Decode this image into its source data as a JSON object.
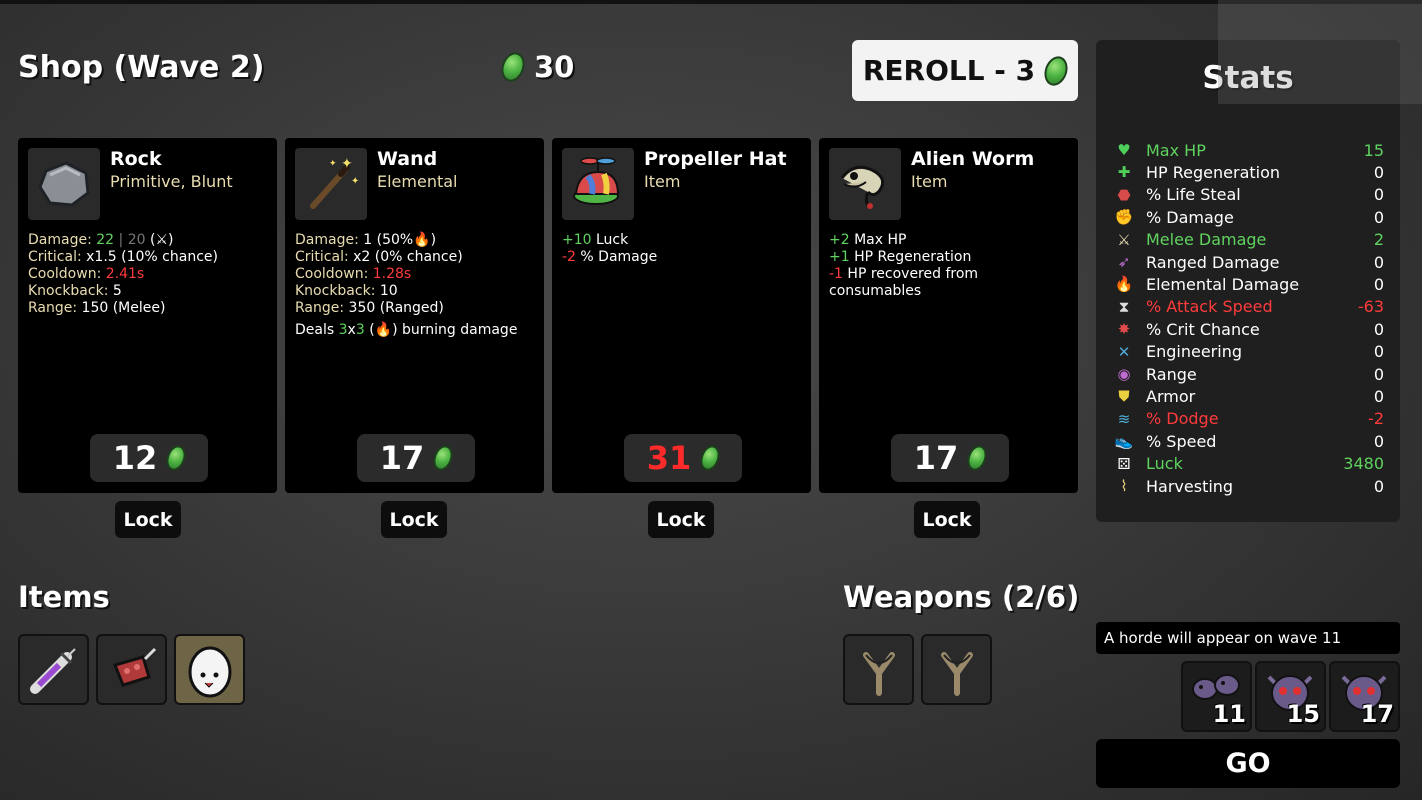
{
  "header": {
    "title": "Shop (Wave 2)",
    "gold": "30",
    "reroll_label": "REROLL - 3"
  },
  "shop": [
    {
      "name": "Rock",
      "type": "Primitive, Blunt",
      "icon": "rock-icon",
      "price": "12",
      "price_color": "#ffffff",
      "lock_label": "Lock",
      "lines": [
        {
          "label": "Damage:",
          "parts": [
            {
              "t": " "
            },
            {
              "t": "22",
              "c": "green"
            },
            {
              "t": " | ",
              "c": "grey"
            },
            {
              "t": "20",
              "c": "grey"
            },
            {
              "t": " (⚔)"
            }
          ]
        },
        {
          "label": "Critical:",
          "parts": [
            {
              "t": " x1.5 (10% chance)"
            }
          ]
        },
        {
          "label": "Cooldown:",
          "parts": [
            {
              "t": " "
            },
            {
              "t": "2.41s",
              "c": "red"
            }
          ]
        },
        {
          "label": "Knockback:",
          "parts": [
            {
              "t": " 5"
            }
          ]
        },
        {
          "label": "Range:",
          "parts": [
            {
              "t": " 150 (Melee)"
            }
          ]
        }
      ]
    },
    {
      "name": "Wand",
      "type": "Elemental",
      "icon": "wand-icon",
      "price": "17",
      "price_color": "#ffffff",
      "lock_label": "Lock",
      "lines": [
        {
          "label": "Damage:",
          "parts": [
            {
              "t": " 1 (50%🔥)"
            }
          ]
        },
        {
          "label": "Critical:",
          "parts": [
            {
              "t": " x2 (0% chance)"
            }
          ]
        },
        {
          "label": "Cooldown:",
          "parts": [
            {
              "t": " "
            },
            {
              "t": "1.28s",
              "c": "red"
            }
          ]
        },
        {
          "label": "Knockback:",
          "parts": [
            {
              "t": " 10"
            }
          ]
        },
        {
          "label": "Range:",
          "parts": [
            {
              "t": " 350 (Ranged)"
            }
          ]
        },
        {
          "label": "",
          "parts": [
            {
              "t": "Deals "
            },
            {
              "t": "3",
              "c": "green"
            },
            {
              "t": "x"
            },
            {
              "t": "3",
              "c": "green"
            },
            {
              "t": " (🔥) burning damage"
            }
          ]
        }
      ]
    },
    {
      "name": "Propeller Hat",
      "type": "Item",
      "icon": "propeller-hat-icon",
      "price": "31",
      "price_color": "#ff2a2a",
      "lock_label": "Lock",
      "lines": [
        {
          "label": "",
          "parts": [
            {
              "t": "+10",
              "c": "green"
            },
            {
              "t": " Luck"
            }
          ]
        },
        {
          "label": "",
          "parts": [
            {
              "t": "-2",
              "c": "red"
            },
            {
              "t": " % Damage"
            }
          ]
        }
      ]
    },
    {
      "name": "Alien Worm",
      "type": "Item",
      "icon": "alien-worm-icon",
      "price": "17",
      "price_color": "#ffffff",
      "lock_label": "Lock",
      "lines": [
        {
          "label": "",
          "parts": [
            {
              "t": "+2",
              "c": "green"
            },
            {
              "t": " Max HP"
            }
          ]
        },
        {
          "label": "",
          "parts": [
            {
              "t": "+1",
              "c": "green"
            },
            {
              "t": " HP Regeneration"
            }
          ]
        },
        {
          "label": "",
          "parts": [
            {
              "t": "-1",
              "c": "red"
            },
            {
              "t": " HP recovered from"
            }
          ]
        },
        {
          "label": "",
          "parts": [
            {
              "t": "consumables"
            }
          ]
        }
      ]
    }
  ],
  "items_section": {
    "title": "Items",
    "items": [
      "syringe-icon",
      "meat-icon",
      "egg-icon"
    ]
  },
  "weapons_section": {
    "title": "Weapons (2/6)",
    "weapons": [
      "slingshot-icon",
      "slingshot-icon"
    ]
  },
  "stats": {
    "title": "Stats",
    "rows": [
      {
        "label": "Max HP",
        "value": "15",
        "state": "green",
        "icon": "heart-icon",
        "glyph": "♥",
        "color": "#4fd05a"
      },
      {
        "label": "HP Regeneration",
        "value": "0",
        "state": "normal",
        "icon": "regen-icon",
        "glyph": "✚",
        "color": "#4fd05a"
      },
      {
        "label": "% Life Steal",
        "value": "0",
        "state": "normal",
        "icon": "life-steal-icon",
        "glyph": "⬣",
        "color": "#d94a4a"
      },
      {
        "label": "% Damage",
        "value": "0",
        "state": "normal",
        "icon": "damage-icon",
        "glyph": "✊",
        "color": "#e06060"
      },
      {
        "label": "Melee Damage",
        "value": "2",
        "state": "green",
        "icon": "melee-icon",
        "glyph": "⚔",
        "color": "#e8dcb0"
      },
      {
        "label": "Ranged Damage",
        "value": "0",
        "state": "normal",
        "icon": "ranged-icon",
        "glyph": "➶",
        "color": "#c06bd0"
      },
      {
        "label": "Elemental Damage",
        "value": "0",
        "state": "normal",
        "icon": "elemental-icon",
        "glyph": "🔥",
        "color": "#e38a4a"
      },
      {
        "label": "% Attack Speed",
        "value": "-63",
        "state": "red",
        "icon": "attack-speed-icon",
        "glyph": "⧗",
        "color": "#dddddd"
      },
      {
        "label": "% Crit Chance",
        "value": "0",
        "state": "normal",
        "icon": "crit-icon",
        "glyph": "✸",
        "color": "#e04a4a"
      },
      {
        "label": "Engineering",
        "value": "0",
        "state": "normal",
        "icon": "engineering-icon",
        "glyph": "✕",
        "color": "#4fa8d8"
      },
      {
        "label": "Range",
        "value": "0",
        "state": "normal",
        "icon": "range-icon",
        "glyph": "◉",
        "color": "#c06bd0"
      },
      {
        "label": "Armor",
        "value": "0",
        "state": "normal",
        "icon": "armor-icon",
        "glyph": "⛊",
        "color": "#e8d040"
      },
      {
        "label": "% Dodge",
        "value": "-2",
        "state": "red",
        "icon": "dodge-icon",
        "glyph": "≋",
        "color": "#4fb0d8"
      },
      {
        "label": "% Speed",
        "value": "0",
        "state": "normal",
        "icon": "speed-icon",
        "glyph": "👟",
        "color": "#dddddd"
      },
      {
        "label": "Luck",
        "value": "3480",
        "state": "green",
        "icon": "luck-icon",
        "glyph": "⚄",
        "color": "#ffffff"
      },
      {
        "label": "Harvesting",
        "value": "0",
        "state": "normal",
        "icon": "harvesting-icon",
        "glyph": "⌇",
        "color": "#e8d080"
      }
    ]
  },
  "horde": {
    "message": "A horde will appear on wave 11",
    "waves": [
      {
        "number": "11",
        "icon": "bug-swarm-icon"
      },
      {
        "number": "15",
        "icon": "horned-skull-icon"
      },
      {
        "number": "17",
        "icon": "horned-skull-icon"
      }
    ]
  },
  "go_label": "GO"
}
